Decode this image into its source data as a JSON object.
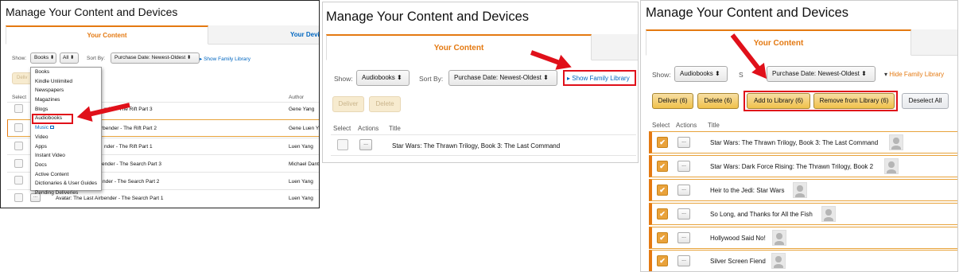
{
  "common": {
    "page_title": "Manage Your Content and Devices",
    "tab_content": "Your Content",
    "show_label": "Show:",
    "sort_label": "Sort By:",
    "sort_value": "Purchase Date: Newest-Oldest",
    "ellipsis": "...",
    "dropdown_arrow": "⬍"
  },
  "panel1": {
    "tab_devices": "Your Devic",
    "show_value": "Books",
    "show_filter": "All",
    "family_link": "Show Family Library",
    "deliver_partial": "Deliv",
    "select_header": "Select",
    "author_header": "Author",
    "dropdown_items": [
      "Books",
      "Kindle Unlimited",
      "Newspapers",
      "Magazines",
      "Blogs",
      "Audiobooks",
      "Music",
      "Video",
      "Apps",
      "Instant Video",
      "Docs",
      "Active Content",
      "Dictionaries & User Guides",
      "Pending Deliveries"
    ],
    "rows": [
      {
        "title": "nder - The Rift Part 3",
        "author": "Gene Yang"
      },
      {
        "title": "rbender - The Rift Part 2",
        "author": "Gene Luen Y"
      },
      {
        "title": "nder - The Rift Part 1",
        "author": "Luen Yang"
      },
      {
        "title": "ender - The Search Part 3",
        "author": "Michael Dant"
      },
      {
        "title": "nder - The Search Part 2",
        "author": "Luen Yang"
      },
      {
        "title": "Avatar: The Last Airbender - The Search Part 1",
        "author": "Luen Yang"
      }
    ]
  },
  "panel2": {
    "show_value": "Audiobooks",
    "family_link": "Show Family Library",
    "deliver": "Deliver",
    "delete": "Delete",
    "select_header": "Select",
    "actions_header": "Actions",
    "title_header": "Title",
    "row_title": "Star Wars: The Thrawn Trilogy, Book 3: The Last Command"
  },
  "panel3": {
    "show_value": "Audiobooks",
    "sort_partial": "S",
    "family_link": "Hide Family Library",
    "deliver": "Deliver (6)",
    "delete": "Delete (6)",
    "add_to_library": "Add to Library (6)",
    "remove_from_library": "Remove from Library (6)",
    "deselect_all": "Deselect All",
    "select_header": "Select",
    "actions_header": "Actions",
    "title_header": "Title",
    "check": "✔",
    "rows": [
      "Star Wars: The Thrawn Trilogy, Book 3: The Last Command",
      "Star Wars: Dark Force Rising: The Thrawn Trilogy, Book 2",
      "Heir to the Jedi: Star Wars",
      "So Long, and Thanks for All the Fish",
      "Hollywood Said No!",
      "Silver Screen Fiend"
    ]
  },
  "colors": {
    "accent": "#e47911",
    "link": "#0066c0",
    "highlight": "#e0101a"
  }
}
